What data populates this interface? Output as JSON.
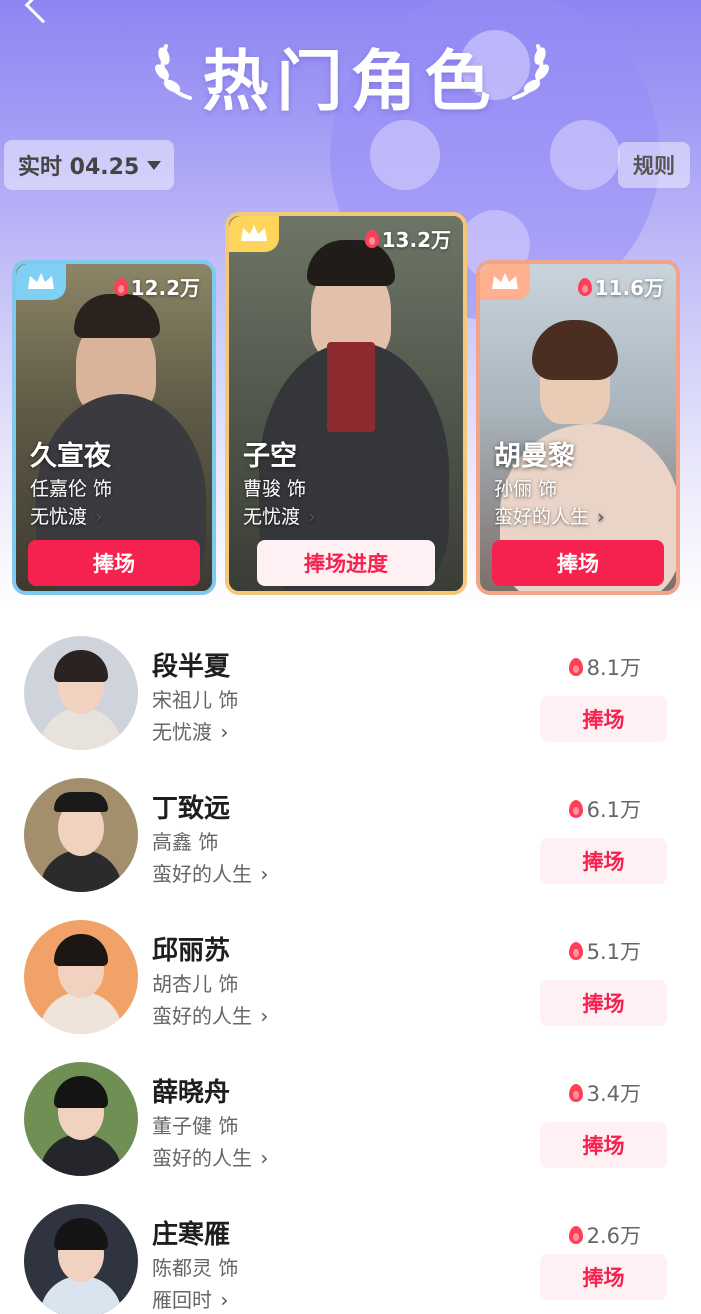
{
  "header": {
    "title": "热门角色",
    "date_label": "实时 04.25",
    "rules_label": "规则"
  },
  "top3": [
    {
      "rank": 2,
      "character": "久宣夜",
      "actor": "任嘉伦 饰",
      "drama": "无忧渡",
      "heat": "12.2万",
      "button": "捧场",
      "crown_color": "#7fd0f5"
    },
    {
      "rank": 1,
      "character": "子空",
      "actor": "曹骏 饰",
      "drama": "无忧渡",
      "heat": "13.2万",
      "button": "捧场进度",
      "crown_color": "#ffd45a"
    },
    {
      "rank": 3,
      "character": "胡曼黎",
      "actor": "孙俪 饰",
      "drama": "蛮好的人生",
      "heat": "11.6万",
      "button": "捧场",
      "crown_color": "#ffb08e"
    }
  ],
  "list": [
    {
      "character": "段半夏",
      "actor": "宋祖儿 饰",
      "drama": "无忧渡",
      "heat": "8.1万",
      "button": "捧场"
    },
    {
      "character": "丁致远",
      "actor": "高鑫 饰",
      "drama": "蛮好的人生",
      "heat": "6.1万",
      "button": "捧场"
    },
    {
      "character": "邱丽苏",
      "actor": "胡杏儿 饰",
      "drama": "蛮好的人生",
      "heat": "5.1万",
      "button": "捧场"
    },
    {
      "character": "薛晓舟",
      "actor": "董子健 饰",
      "drama": "蛮好的人生",
      "heat": "3.4万",
      "button": "捧场"
    },
    {
      "character": "庄寒雁",
      "actor": "陈都灵 饰",
      "drama": "雁回时",
      "heat": "2.6万",
      "button": "捧场"
    }
  ],
  "colors": {
    "accent": "#f5214f",
    "button_light_bg": "#fff0f3"
  }
}
